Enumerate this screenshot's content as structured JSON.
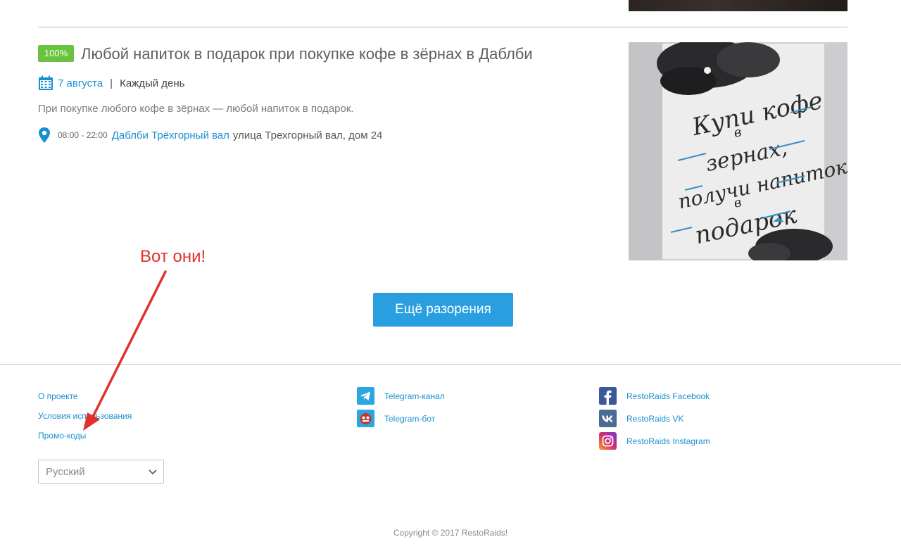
{
  "offer": {
    "badge": "100%",
    "title": "Любой напиток в подарок при покупке кофе в зёрнах в Даблби",
    "date": "7 августа",
    "separator": "|",
    "frequency": "Каждый день",
    "description": "При покупке любого кофе в зёрнах — любой напиток в подарок.",
    "hours": "08:00 - 22:00",
    "place": "Даблби Трёхгорный вал",
    "address": "улица Трехгорный вал, дом 24",
    "image_text": [
      "Купи кофе",
      "в",
      "зернах,",
      "получи напиток",
      "в",
      "подарок"
    ]
  },
  "annotation": {
    "note": "Вот они!"
  },
  "more_button": {
    "label": "Ещё разорения"
  },
  "footer": {
    "links": [
      "О проекте",
      "Условия использования",
      "Промо-коды"
    ],
    "telegram": [
      {
        "label": "Telegram-канал",
        "icon": "telegram-icon"
      },
      {
        "label": "Telegram-бот",
        "icon": "bot-icon"
      }
    ],
    "social": [
      {
        "label": "RestoRaids Facebook",
        "icon": "facebook-icon"
      },
      {
        "label": "RestoRaids VK",
        "icon": "vk-icon"
      },
      {
        "label": "RestoRaids Instagram",
        "icon": "instagram-icon"
      }
    ],
    "language": "Русский",
    "copyright": "Copyright © 2017 RestoRaids!"
  },
  "colors": {
    "accent": "#2a9fe0",
    "link": "#1a8fd0",
    "badge": "#6ac33c",
    "annotation": "#e0322c"
  }
}
